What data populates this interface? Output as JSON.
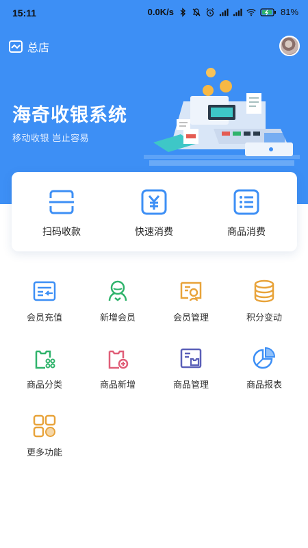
{
  "status_bar": {
    "time": "15:11",
    "network_speed": "0.0K/s",
    "battery": "81"
  },
  "header": {
    "store_label": "总店",
    "store_icon": "store-icon",
    "avatar_icon": "user-avatar"
  },
  "banner": {
    "title": "海奇收银系统",
    "subtitle": "移动收银 岂止容易"
  },
  "quick_actions": [
    {
      "label": "扫码收款",
      "icon": "scan-icon"
    },
    {
      "label": "快速消费",
      "icon": "yuan-icon"
    },
    {
      "label": "商品消费",
      "icon": "list-icon"
    }
  ],
  "menu": [
    {
      "label": "会员充值",
      "icon": "card-recharge-icon",
      "color": "#3d8ff5"
    },
    {
      "label": "新增会员",
      "icon": "add-member-icon",
      "color": "#2fb36b"
    },
    {
      "label": "会员管理",
      "icon": "member-manage-icon",
      "color": "#e8a33a"
    },
    {
      "label": "积分变动",
      "icon": "points-coins-icon",
      "color": "#e8a33a"
    },
    {
      "label": "商品分类",
      "icon": "goods-category-icon",
      "color": "#2fb36b"
    },
    {
      "label": "商品新增",
      "icon": "goods-add-icon",
      "color": "#e05e78"
    },
    {
      "label": "商品管理",
      "icon": "goods-manage-icon",
      "color": "#5a5fb8"
    },
    {
      "label": "商品报表",
      "icon": "pie-report-icon",
      "color": "#3d8ff5"
    },
    {
      "label": "更多功能",
      "icon": "more-grid-icon",
      "color": "#e8a33a"
    }
  ],
  "colors": {
    "primary": "#3d8ff5",
    "background": "#ffffff"
  }
}
